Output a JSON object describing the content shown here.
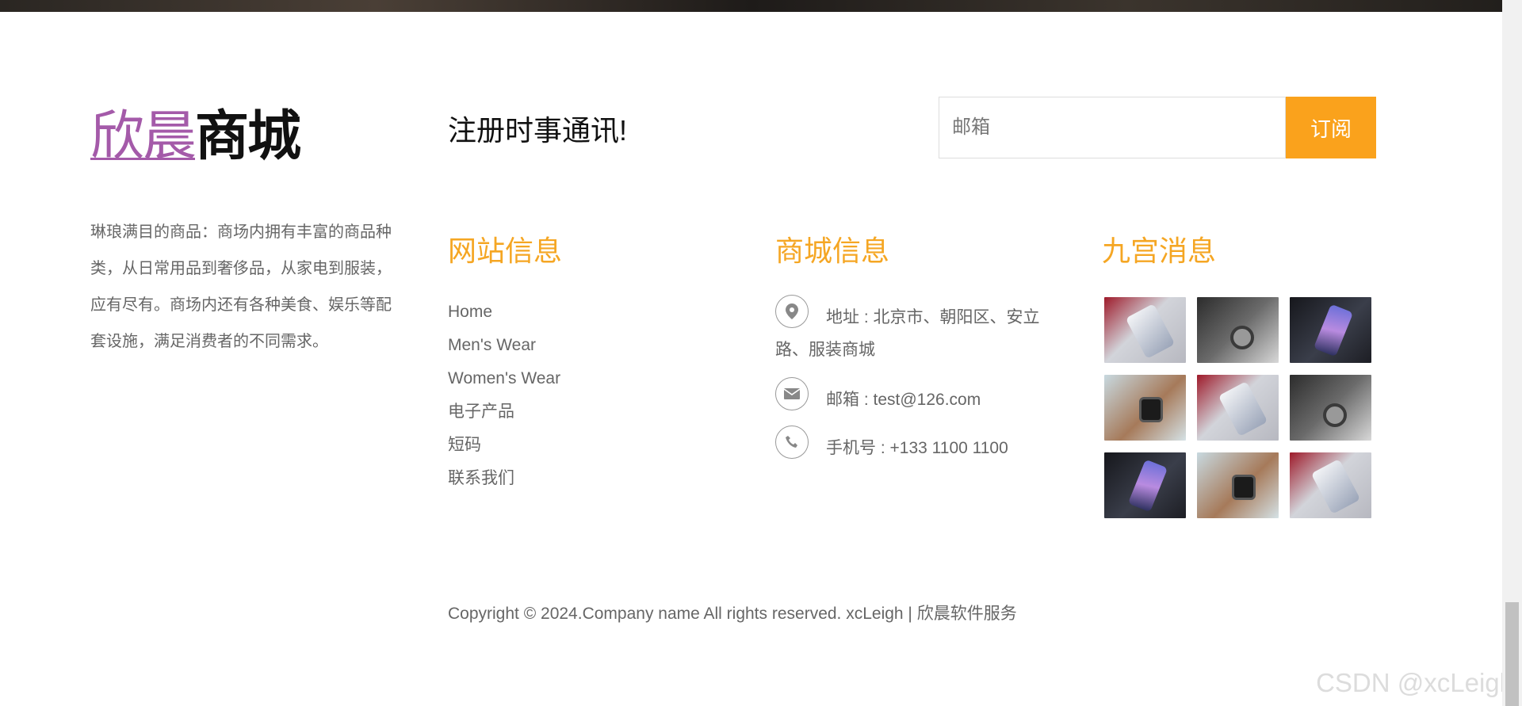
{
  "logo": {
    "accent": "欣晨",
    "main": "商城"
  },
  "about": {
    "text": "琳琅满目的商品：商场内拥有丰富的商品种类，从日常用品到奢侈品，从家电到服装，应有尽有。商场内还有各种美食、娱乐等配套设施，满足消费者的不同需求。"
  },
  "newsletter": {
    "title": "注册时事通讯!",
    "email_placeholder": "邮箱",
    "subscribe_label": "订阅"
  },
  "site_info": {
    "title": "网站信息",
    "links": [
      "Home",
      "Men's Wear",
      "Women's Wear",
      "电子产品",
      "短码",
      "联系我们"
    ]
  },
  "mall_info": {
    "title": "商城信息",
    "address": "地址 : 北京市、朝阳区、安立路、服装商城",
    "email": "邮箱 : test@126.com",
    "phone": "手机号 : +133 1100 1100"
  },
  "gallery": {
    "title": "九宫消息",
    "images": [
      "phone-hand-red",
      "watch-suit-gray",
      "phone-dark",
      "watch-hand-teal",
      "phone-hand-red",
      "watch-suit-gray",
      "phone-dark",
      "watch-hand-teal",
      "phone-hand-red"
    ]
  },
  "footer": {
    "copyright": "Copyright © 2024.Company name All rights reserved. xcLeigh | 欣晨软件服务"
  },
  "watermark": "CSDN @xcLeigh",
  "colors": {
    "accent": "#f5a623",
    "button": "#faa21c",
    "logo_accent": "#a45aa9"
  }
}
